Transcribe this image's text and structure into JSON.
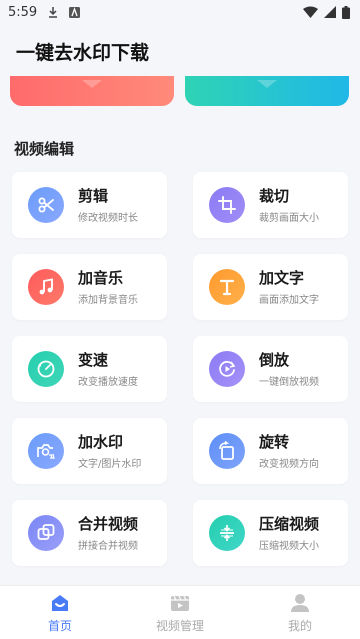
{
  "status_bar": {
    "time": "5:59"
  },
  "app": {
    "title": "一键去水印下载"
  },
  "section": {
    "title": "视频编辑"
  },
  "tools": [
    {
      "name": "剪辑",
      "desc": "修改视频时长",
      "icon": "scissors-icon",
      "color_from": "#6a9cf9",
      "color_to": "#8aa8ff"
    },
    {
      "name": "裁切",
      "desc": "裁剪画面大小",
      "icon": "crop-icon",
      "color_from": "#8b7bf4",
      "color_to": "#a08df7"
    },
    {
      "name": "加音乐",
      "desc": "添加背景音乐",
      "icon": "music-note-icon",
      "color_from": "#ff5b5b",
      "color_to": "#ff7a6a"
    },
    {
      "name": "加文字",
      "desc": "画面添加文字",
      "icon": "text-t-icon",
      "color_from": "#ff9a2e",
      "color_to": "#ffb04a"
    },
    {
      "name": "变速",
      "desc": "改变播放速度",
      "icon": "speedometer-icon",
      "color_from": "#25cfae",
      "color_to": "#3fd6b8"
    },
    {
      "name": "倒放",
      "desc": "一键倒放视频",
      "icon": "reverse-play-icon",
      "color_from": "#8a7bf4",
      "color_to": "#a792f8"
    },
    {
      "name": "加水印",
      "desc": "文字/图片水印",
      "icon": "watermark-icon",
      "color_from": "#6a9cf9",
      "color_to": "#8aa8ff"
    },
    {
      "name": "旋转",
      "desc": "改变视频方向",
      "icon": "rotate-icon",
      "color_from": "#5f8ef7",
      "color_to": "#7ea4fa"
    },
    {
      "name": "合并视频",
      "desc": "拼接合并视频",
      "icon": "merge-icon",
      "color_from": "#7a86f5",
      "color_to": "#9a9ff9"
    },
    {
      "name": "压缩视频",
      "desc": "压缩视频大小",
      "icon": "compress-icon",
      "color_from": "#25cfae",
      "color_to": "#3fd6c8"
    }
  ],
  "nav": [
    {
      "label": "首页",
      "icon": "home-icon",
      "active": true
    },
    {
      "label": "视频管理",
      "icon": "video-manage-icon",
      "active": false
    },
    {
      "label": "我的",
      "icon": "user-icon",
      "active": false
    }
  ],
  "colors": {
    "accent": "#4a7bf7",
    "background": "#f5f6fa"
  }
}
